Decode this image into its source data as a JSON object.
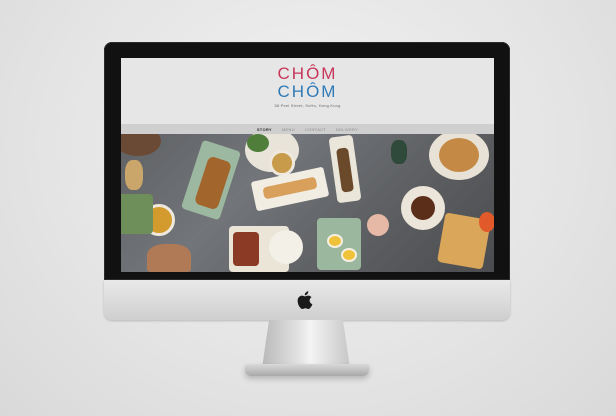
{
  "site": {
    "logo_line1": "CHÔM",
    "logo_line2": "CHÔM",
    "address": "58 Peel Street, SoHo, Hong Kong"
  },
  "nav": {
    "items": [
      {
        "label": "STORY",
        "active": true
      },
      {
        "label": "MENU",
        "active": false
      },
      {
        "label": "CONTACT",
        "active": false
      },
      {
        "label": "DELIVERY",
        "active": false
      }
    ]
  },
  "colors": {
    "logo_top": "#c8365a",
    "logo_bottom": "#2f7bb8",
    "header_bg": "#e6e6e6",
    "nav_bg": "#cfcfcf"
  },
  "device": {
    "logo_icon": "apple-icon"
  }
}
